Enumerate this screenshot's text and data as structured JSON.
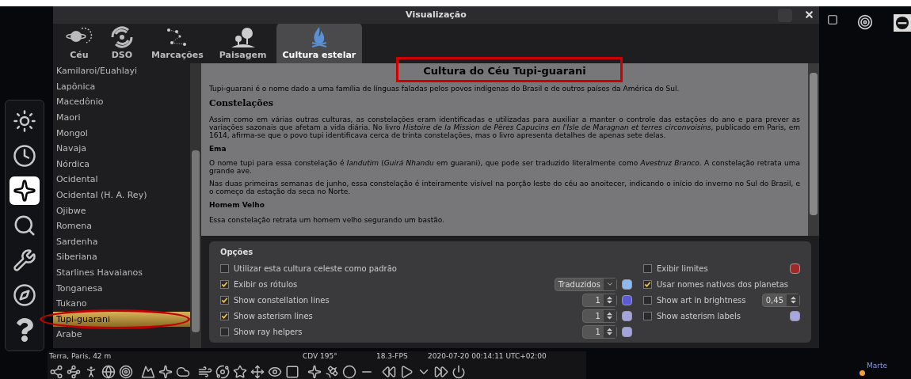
{
  "window": {
    "title": "Visualização"
  },
  "tabs": [
    {
      "label": "Céu",
      "kind": "sky",
      "selected": false
    },
    {
      "label": "DSO",
      "kind": "galaxy",
      "selected": false
    },
    {
      "label": "Marcações",
      "kind": "markings",
      "selected": false
    },
    {
      "label": "Paisagem",
      "kind": "landscape",
      "selected": false
    },
    {
      "label": "Cultura estelar",
      "kind": "culture",
      "selected": true
    }
  ],
  "left_toolbar": [
    {
      "kind": "sun",
      "selected": false
    },
    {
      "kind": "clock",
      "selected": false
    },
    {
      "kind": "sky",
      "selected": true
    },
    {
      "kind": "search",
      "selected": false
    },
    {
      "kind": "wrench",
      "selected": false
    },
    {
      "kind": "compass",
      "selected": false
    },
    {
      "kind": "help",
      "selected": false
    }
  ],
  "cultures": [
    {
      "label": "Kamilaroi/Euahlayi",
      "selected": false
    },
    {
      "label": "Lapônica",
      "selected": false
    },
    {
      "label": "Macedônio",
      "selected": false
    },
    {
      "label": "Maori",
      "selected": false
    },
    {
      "label": "Mongol",
      "selected": false
    },
    {
      "label": "Navaja",
      "selected": false
    },
    {
      "label": "Nórdica",
      "selected": false
    },
    {
      "label": "Ocidental",
      "selected": false
    },
    {
      "label": "Ocidental (H. A. Rey)",
      "selected": false
    },
    {
      "label": "Ojibwe",
      "selected": false
    },
    {
      "label": "Romena",
      "selected": false
    },
    {
      "label": "Sardenha",
      "selected": false
    },
    {
      "label": "Siberiana",
      "selected": false
    },
    {
      "label": "Starlines Havaianos",
      "selected": false
    },
    {
      "label": "Tonganesa",
      "selected": false
    },
    {
      "label": "Tukano",
      "selected": false
    },
    {
      "label": "Tupi-guarani",
      "selected": true
    },
    {
      "label": "Arabe",
      "selected": false
    }
  ],
  "description": {
    "title": "Cultura do Céu Tupi-guarani",
    "blocks": [
      {
        "kind": "paragraph",
        "text": "Tupi-guarani é o nome dado a uma família de línguas faladas pelos povos indígenas do Brasil e de outros países da América do Sul."
      },
      {
        "kind": "heading",
        "text": "Constelações"
      },
      {
        "kind": "paragraph",
        "text": "Assim como em várias outras culturas, as constelações eram identificadas e utilizadas para auxiliar a manter o controle das estações do ano e para prever as variações sazonais que afetam a vida diária. No livro *Histoire de la Mission de Pères Capucins en l'Isle de Maragnan et terres circonvoisins*, publicado em Paris, em 1614, afirma-se que o povo tupi identificava cerca de trinta constelações, mas o livro apresenta detalhes de apenas sete delas."
      },
      {
        "kind": "subheading",
        "text": "Ema"
      },
      {
        "kind": "paragraph",
        "text": "O nome tupi para essa constelação é *Iandutim* (*Guirá Nhandu* em guarani), que pode ser traduzido literalmente como *Avestruz Branco*. A constelação retrata uma grande ave."
      },
      {
        "kind": "paragraph",
        "text": "Nas duas primeiras semanas de junho, essa constelação é inteiramente visível na porção leste do céu ao anoitecer, indicando o início do inverno no Sul do Brasil, e o começo da estação da seca no Norte."
      },
      {
        "kind": "subheading",
        "text": "Homem Velho"
      },
      {
        "kind": "paragraph",
        "text": "Essa constelação retrata um homem velho segurando um bastão."
      }
    ]
  },
  "options": {
    "title": "Opções",
    "left": [
      {
        "label": "Utilizar esta cultura celeste como padrão",
        "checked": false
      },
      {
        "label": "Exibir os rótulos",
        "checked": true,
        "kind": "dropdown",
        "value": "Traduzidos",
        "color": "#8fb8ec"
      },
      {
        "label": "Show constellation lines",
        "checked": true,
        "kind": "spinner",
        "value": "1",
        "color": "#5b5bd6"
      },
      {
        "label": "Show asterism lines",
        "checked": true,
        "kind": "spinner",
        "value": "1",
        "color": "#a4a4dc"
      },
      {
        "label": "Show ray helpers",
        "checked": false,
        "kind": "spinner",
        "value": "1",
        "color": "#a4a4dc"
      }
    ],
    "right": [
      {
        "label": "Exibir limites",
        "checked": false,
        "color": "#9c2a2a"
      },
      {
        "label": "Usar nomes nativos dos planetas",
        "checked": true
      },
      {
        "label": "Show art in brightness",
        "checked": false,
        "kind": "spinner",
        "value": "0,45"
      },
      {
        "label": "Show asterism labels",
        "checked": false,
        "color": "#a8a8e0"
      }
    ]
  },
  "status": {
    "location": "Terra, Paris, 42 m",
    "fov": "CDV 195°",
    "fps": "18.3-FPS",
    "datetime": "2020-07-20 00:14:11 UTC+02:00"
  },
  "sky_labels": [
    {
      "label": "Marte"
    }
  ]
}
